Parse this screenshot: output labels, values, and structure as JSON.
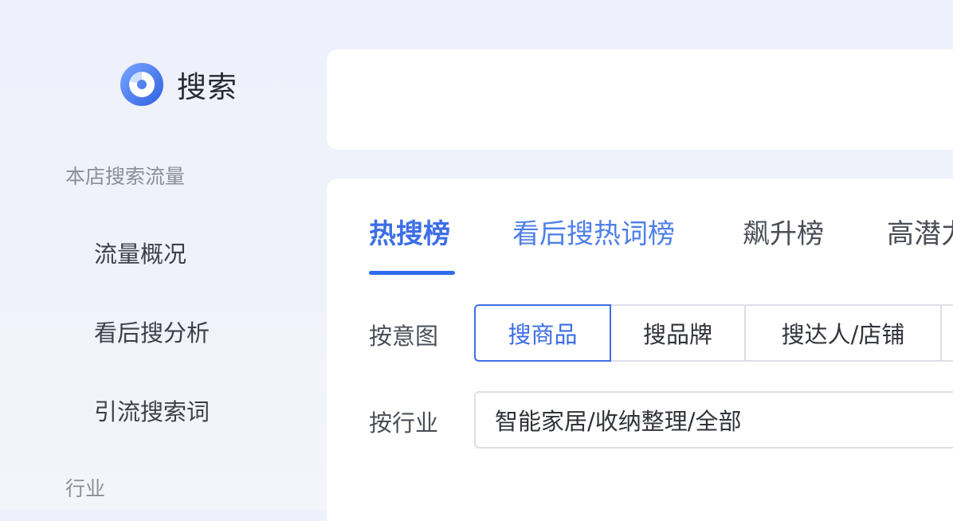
{
  "brand": {
    "title": "搜索",
    "logo_icon": "search-logo-icon"
  },
  "sidebar": {
    "sections": [
      {
        "title": "本店搜索流量",
        "items": [
          {
            "label": "流量概况"
          },
          {
            "label": "看后搜分析"
          },
          {
            "label": "引流搜索词"
          }
        ]
      },
      {
        "title": "行业",
        "items": []
      }
    ]
  },
  "tabs": [
    {
      "label": "热搜榜",
      "active": true
    },
    {
      "label": "看后搜热词榜",
      "active": false
    },
    {
      "label": "飙升榜",
      "active": false
    },
    {
      "label": "高潜力",
      "active": false
    }
  ],
  "filters": {
    "intent": {
      "label": "按意图",
      "options": [
        "搜商品",
        "搜品牌",
        "搜达人/店铺"
      ],
      "selected": "搜商品"
    },
    "industry": {
      "label": "按行业",
      "value": "智能家居/收纳整理/全部"
    }
  },
  "colors": {
    "accent": "#3d6ee6",
    "underline": "#2f6bf0",
    "background": "#eef0fb",
    "card": "#ffffff"
  }
}
